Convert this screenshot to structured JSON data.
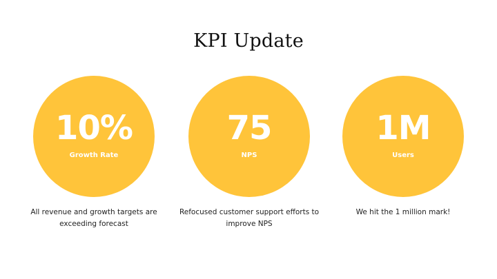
{
  "slide": {
    "title": "KPI Update",
    "accent_color": "#FFC43A",
    "kpis": [
      {
        "value": "10%",
        "label": "Growth Rate",
        "description": "All revenue and growth targets are exceeding forecast"
      },
      {
        "value": "75",
        "label": "NPS",
        "description": "Refocused customer support efforts to improve NPS"
      },
      {
        "value": "1M",
        "label": "Users",
        "description": "We hit the 1 million mark!"
      }
    ]
  }
}
